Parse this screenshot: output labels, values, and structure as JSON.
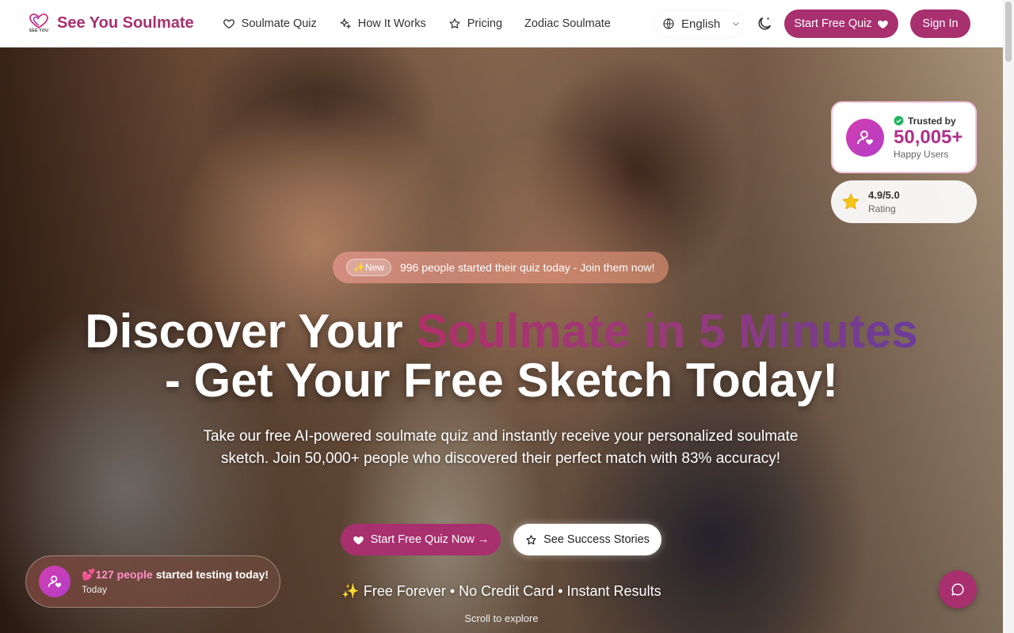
{
  "nav": {
    "logo_sub": "SEE YOU",
    "brand": "See You Soulmate",
    "links": [
      {
        "label": "Soulmate Quiz",
        "icon": "heart-outline-icon"
      },
      {
        "label": "How It Works",
        "icon": "sparkles-icon"
      },
      {
        "label": "Pricing",
        "icon": "star-outline-icon"
      },
      {
        "label": "Zodiac Soulmate",
        "icon": ""
      }
    ],
    "language": "English",
    "start_quiz": "Start Free Quiz",
    "sign_in": "Sign In"
  },
  "trust": {
    "label": "Trusted by",
    "count": "50,005+",
    "sub": "Happy Users"
  },
  "rating": {
    "value": "4.9/5.0",
    "label": "Rating"
  },
  "announcement": {
    "badge": "✨New",
    "text": "996 people started their quiz today - Join them now!"
  },
  "headline": {
    "line1_plain": "Discover Your ",
    "line1_highlight": "Soulmate in 5 Minutes",
    "line2": "- Get Your Free Sketch Today!"
  },
  "subtext": "Take our free AI-powered soulmate quiz and instantly receive your personalized soulmate sketch. Join 50,000+ people who discovered their perfect match with 83% accuracy!",
  "cta": {
    "primary": "Start Free Quiz Now →",
    "secondary": "See Success Stories"
  },
  "perks": "✨ Free Forever • No Credit Card • Instant Results",
  "scroll_hint": "Scroll to explore",
  "toast": {
    "emoji": "💕",
    "count": "127 people",
    "rest": " started testing today!",
    "sub": "Today"
  },
  "colors": {
    "brand": "#a8306f",
    "accent_gradient_start": "#b0306a",
    "accent_gradient_end": "#6a3c9a"
  }
}
